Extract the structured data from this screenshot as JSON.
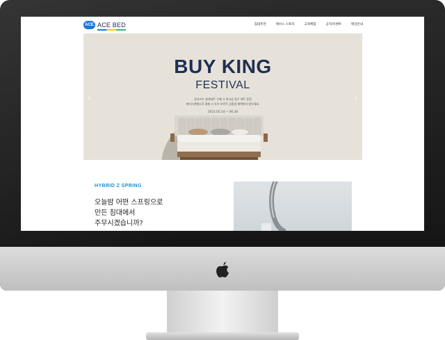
{
  "site": {
    "logo_badge": "ACE",
    "logo_text": "ACE BED",
    "nav": [
      "침대추천",
      "에이스 스토리",
      "고객체험",
      "공지/이벤트",
      "매장안내"
    ]
  },
  "hero": {
    "title": "BUY KING",
    "subtitle": "FESTIVAL",
    "desc_line1": "킹사이즈 침대세트 구매 시 최고급 침구 세트 증정",
    "desc_line2": "에이스앤젤스로 결제 시 추가 포인트 상품권 혜택까지 받으세요.",
    "date": "2021.05.14 ~ 06.30",
    "arrow_left": "‹",
    "arrow_right": "›"
  },
  "section": {
    "label": "HYBRID Z SPRING",
    "headline": [
      "오늘밤 어떤 스프링으로",
      "만든 침대에서",
      "주무시겠습니까?"
    ]
  },
  "colors": {
    "hero_bg": "#e6e2da",
    "navy": "#1f2f52",
    "accent_blue": "#1a8fd1"
  },
  "icons": {
    "monitor_logo": "apple-icon"
  }
}
